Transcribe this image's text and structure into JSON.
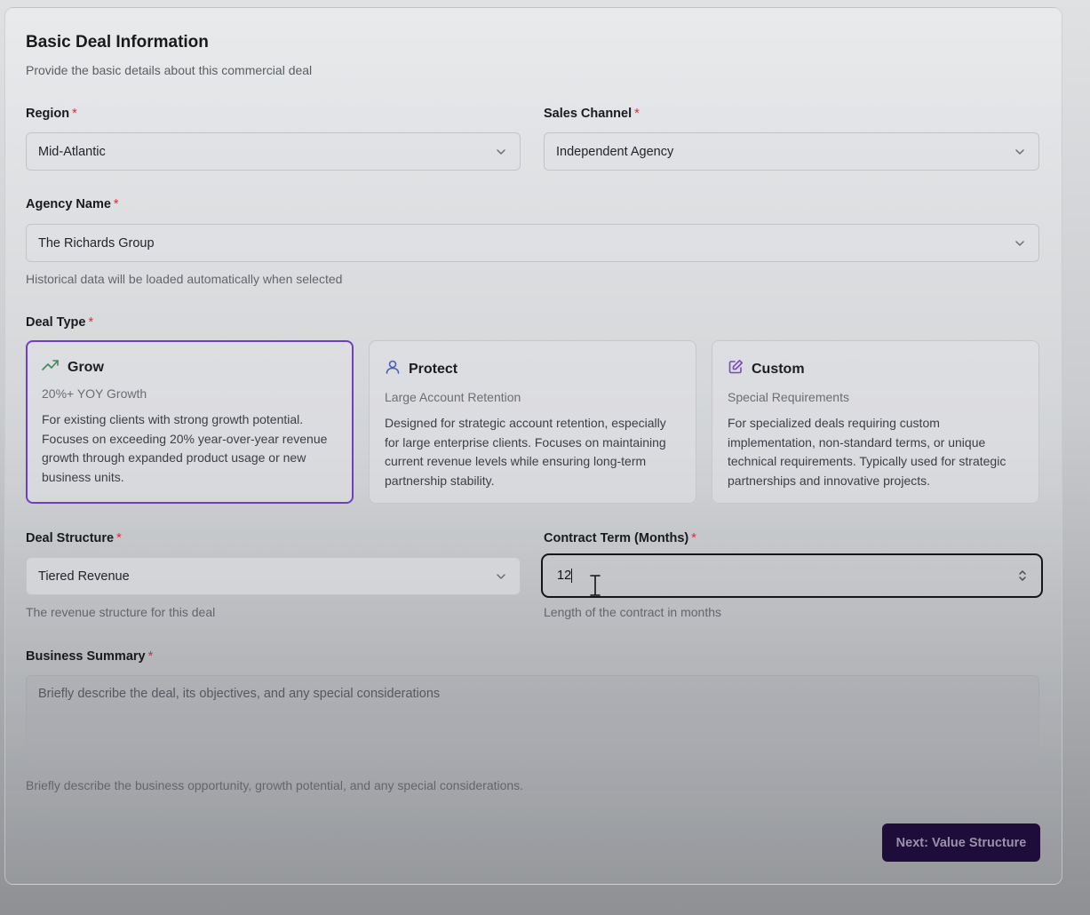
{
  "section": {
    "title": "Basic Deal Information",
    "subtitle": "Provide the basic details about this commercial deal"
  },
  "required_marker": "*",
  "region": {
    "label": "Region",
    "value": "Mid-Atlantic"
  },
  "sales_channel": {
    "label": "Sales Channel",
    "value": "Independent Agency"
  },
  "agency": {
    "label": "Agency Name",
    "value": "The Richards Group",
    "helper": "Historical data will be loaded automatically when selected"
  },
  "deal_type": {
    "label": "Deal Type",
    "selected": "Grow",
    "options": [
      {
        "name": "Grow",
        "icon": "trending-up-icon",
        "subtitle": "20%+ YOY Growth",
        "description": "For existing clients with strong growth potential. Focuses on exceeding 20% year-over-year revenue growth through expanded product usage or new business units."
      },
      {
        "name": "Protect",
        "icon": "user-icon",
        "subtitle": "Large Account Retention",
        "description": "Designed for strategic account retention, especially for large enterprise clients. Focuses on maintaining current revenue levels while ensuring long-term partnership stability."
      },
      {
        "name": "Custom",
        "icon": "edit-icon",
        "subtitle": "Special Requirements",
        "description": "For specialized deals requiring custom implementation, non-standard terms, or unique technical requirements. Typically used for strategic partnerships and innovative projects."
      }
    ]
  },
  "deal_structure": {
    "label": "Deal Structure",
    "value": "Tiered Revenue",
    "helper": "The revenue structure for this deal"
  },
  "contract_term": {
    "label": "Contract Term (Months)",
    "value": "12",
    "helper": "Length of the contract in months"
  },
  "business_summary": {
    "label": "Business Summary",
    "placeholder": "Briefly describe the deal, its objectives, and any special considerations",
    "helper": "Briefly describe the business opportunity, growth potential, and any special considerations."
  },
  "next_button": {
    "label": "Next: Value Structure"
  },
  "colors": {
    "accent": "#6e3fc2",
    "button_bg": "#1e0c3a",
    "required": "#d0303a",
    "grow_icon": "#3f8a5a",
    "protect_icon": "#4a5fb0",
    "custom_icon": "#7a46c4"
  }
}
